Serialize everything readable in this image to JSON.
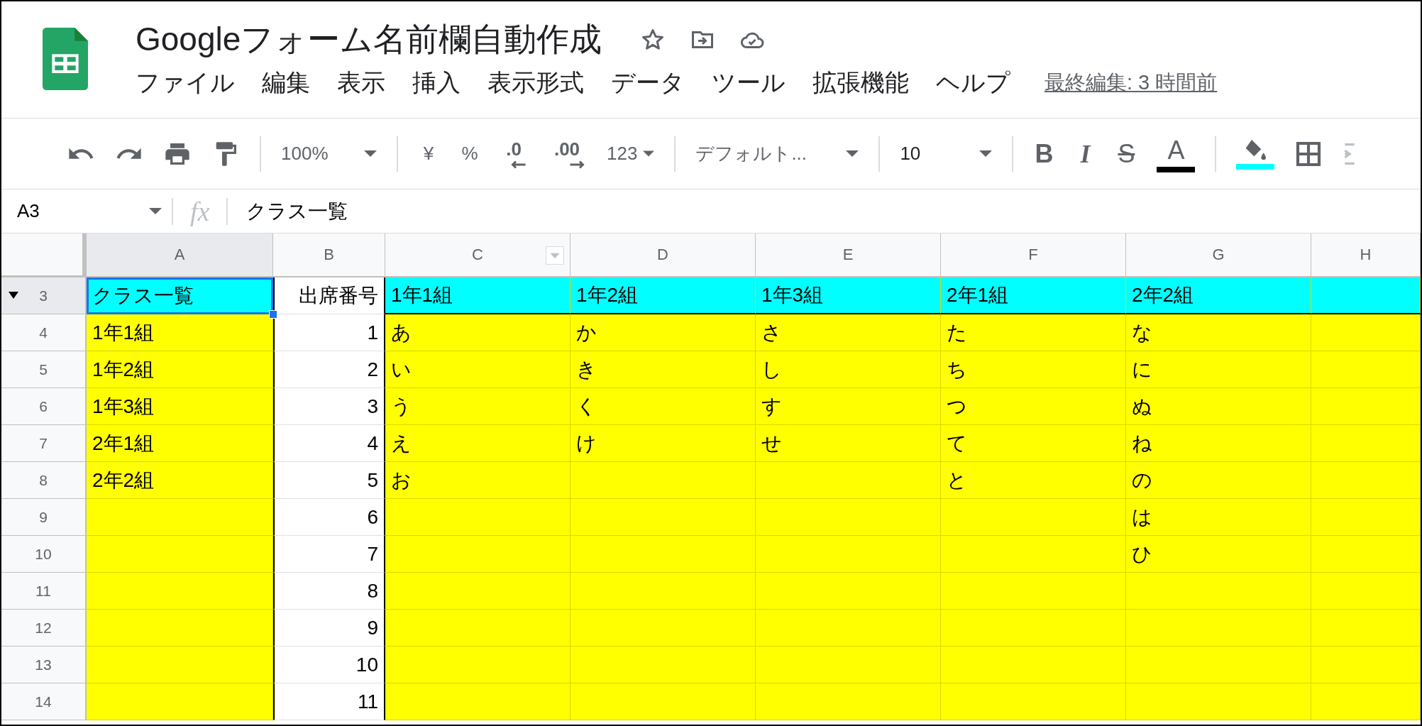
{
  "title": "Googleフォーム名前欄自動作成",
  "menu": [
    "ファイル",
    "編集",
    "表示",
    "挿入",
    "表示形式",
    "データ",
    "ツール",
    "拡張機能",
    "ヘルプ"
  ],
  "last_edit": "最終編集: 3 時間前",
  "toolbar": {
    "zoom": "100%",
    "currency": "¥",
    "percent": "%",
    "decimal_less": ".0",
    "decimal_more": ".00",
    "number_format": "123",
    "font": "デフォルト...",
    "font_size": "10",
    "bold": "B",
    "italic": "I",
    "strike": "S",
    "text_color_button": {
      "letter": "A",
      "color": "#000000"
    },
    "fill_color_button": {
      "color": "#00ffff"
    }
  },
  "name_box": "A3",
  "formula_icon": "fx",
  "formula": "クラス一覧",
  "columns": [
    {
      "label": "A",
      "selected": true,
      "filter": false
    },
    {
      "label": "B",
      "selected": false,
      "filter": false
    },
    {
      "label": "C",
      "selected": false,
      "filter": true
    },
    {
      "label": "D",
      "selected": false,
      "filter": false
    },
    {
      "label": "E",
      "selected": false,
      "filter": false
    },
    {
      "label": "F",
      "selected": false,
      "filter": false
    },
    {
      "label": "G",
      "selected": false,
      "filter": false
    },
    {
      "label": "H",
      "selected": false,
      "filter": false
    }
  ],
  "rows": [
    {
      "number": "3",
      "selected": true,
      "collapsible": true,
      "cells": [
        {
          "text": "クラス一覧",
          "color": "#00ffff",
          "selected": true
        },
        {
          "text": "出席番号",
          "color": "#ffffff",
          "selected": false
        },
        {
          "text": "1年1組",
          "color": "#00ffff",
          "selected": false
        },
        {
          "text": "1年2組",
          "color": "#00ffff",
          "selected": false
        },
        {
          "text": "1年3組",
          "color": "#00ffff",
          "selected": false
        },
        {
          "text": "2年1組",
          "color": "#00ffff",
          "selected": false
        },
        {
          "text": "2年2組",
          "color": "#00ffff",
          "selected": false
        },
        {
          "color": "#00ffff",
          "selected": false
        }
      ]
    },
    {
      "number": "4",
      "selected": false,
      "collapsible": false,
      "cells": [
        {
          "text": "1年1組",
          "color": "#ffff00",
          "selected": false
        },
        {
          "text": "1",
          "color": "#ffffff",
          "selected": false
        },
        {
          "text": "あ",
          "color": "#ffff00",
          "selected": false
        },
        {
          "text": "か",
          "color": "#ffff00",
          "selected": false
        },
        {
          "text": "さ",
          "color": "#ffff00",
          "selected": false
        },
        {
          "text": "た",
          "color": "#ffff00",
          "selected": false
        },
        {
          "text": "な",
          "color": "#ffff00",
          "selected": false
        },
        {
          "color": "#ffff00",
          "selected": false
        }
      ]
    },
    {
      "number": "5",
      "selected": false,
      "collapsible": false,
      "cells": [
        {
          "text": "1年2組",
          "color": "#ffff00",
          "selected": false
        },
        {
          "text": "2",
          "color": "#ffffff",
          "selected": false
        },
        {
          "text": "い",
          "color": "#ffff00",
          "selected": false
        },
        {
          "text": "き",
          "color": "#ffff00",
          "selected": false
        },
        {
          "text": "し",
          "color": "#ffff00",
          "selected": false
        },
        {
          "text": "ち",
          "color": "#ffff00",
          "selected": false
        },
        {
          "text": "に",
          "color": "#ffff00",
          "selected": false
        },
        {
          "color": "#ffff00",
          "selected": false
        }
      ]
    },
    {
      "number": "6",
      "selected": false,
      "collapsible": false,
      "cells": [
        {
          "text": "1年3組",
          "color": "#ffff00",
          "selected": false
        },
        {
          "text": "3",
          "color": "#ffffff",
          "selected": false
        },
        {
          "text": "う",
          "color": "#ffff00",
          "selected": false
        },
        {
          "text": "く",
          "color": "#ffff00",
          "selected": false
        },
        {
          "text": "す",
          "color": "#ffff00",
          "selected": false
        },
        {
          "text": "つ",
          "color": "#ffff00",
          "selected": false
        },
        {
          "text": "ぬ",
          "color": "#ffff00",
          "selected": false
        },
        {
          "color": "#ffff00",
          "selected": false
        }
      ]
    },
    {
      "number": "7",
      "selected": false,
      "collapsible": false,
      "cells": [
        {
          "text": "2年1組",
          "color": "#ffff00",
          "selected": false
        },
        {
          "text": "4",
          "color": "#ffffff",
          "selected": false
        },
        {
          "text": "え",
          "color": "#ffff00",
          "selected": false
        },
        {
          "text": "け",
          "color": "#ffff00",
          "selected": false
        },
        {
          "text": "せ",
          "color": "#ffff00",
          "selected": false
        },
        {
          "text": "て",
          "color": "#ffff00",
          "selected": false
        },
        {
          "text": "ね",
          "color": "#ffff00",
          "selected": false
        },
        {
          "color": "#ffff00",
          "selected": false
        }
      ]
    },
    {
      "number": "8",
      "selected": false,
      "collapsible": false,
      "cells": [
        {
          "text": "2年2組",
          "color": "#ffff00",
          "selected": false
        },
        {
          "text": "5",
          "color": "#ffffff",
          "selected": false
        },
        {
          "text": "お",
          "color": "#ffff00",
          "selected": false
        },
        {
          "color": "#ffff00",
          "selected": false
        },
        {
          "color": "#ffff00",
          "selected": false
        },
        {
          "text": "と",
          "color": "#ffff00",
          "selected": false
        },
        {
          "text": "の",
          "color": "#ffff00",
          "selected": false
        },
        {
          "color": "#ffff00",
          "selected": false
        }
      ]
    },
    {
      "number": "9",
      "selected": false,
      "collapsible": false,
      "cells": [
        {
          "color": "#ffff00",
          "selected": false
        },
        {
          "text": "6",
          "color": "#ffffff",
          "selected": false
        },
        {
          "color": "#ffff00",
          "selected": false
        },
        {
          "color": "#ffff00",
          "selected": false
        },
        {
          "color": "#ffff00",
          "selected": false
        },
        {
          "color": "#ffff00",
          "selected": false
        },
        {
          "text": "は",
          "color": "#ffff00",
          "selected": false
        },
        {
          "color": "#ffff00",
          "selected": false
        }
      ]
    },
    {
      "number": "10",
      "selected": false,
      "collapsible": false,
      "cells": [
        {
          "color": "#ffff00",
          "selected": false
        },
        {
          "text": "7",
          "color": "#ffffff",
          "selected": false
        },
        {
          "color": "#ffff00",
          "selected": false
        },
        {
          "color": "#ffff00",
          "selected": false
        },
        {
          "color": "#ffff00",
          "selected": false
        },
        {
          "color": "#ffff00",
          "selected": false
        },
        {
          "text": "ひ",
          "color": "#ffff00",
          "selected": false
        },
        {
          "color": "#ffff00",
          "selected": false
        }
      ]
    },
    {
      "number": "11",
      "selected": false,
      "collapsible": false,
      "cells": [
        {
          "color": "#ffff00",
          "selected": false
        },
        {
          "text": "8",
          "color": "#ffffff",
          "selected": false
        },
        {
          "color": "#ffff00",
          "selected": false
        },
        {
          "color": "#ffff00",
          "selected": false
        },
        {
          "color": "#ffff00",
          "selected": false
        },
        {
          "color": "#ffff00",
          "selected": false
        },
        {
          "color": "#ffff00",
          "selected": false
        },
        {
          "color": "#ffff00",
          "selected": false
        }
      ]
    },
    {
      "number": "12",
      "selected": false,
      "collapsible": false,
      "cells": [
        {
          "color": "#ffff00",
          "selected": false
        },
        {
          "text": "9",
          "color": "#ffffff",
          "selected": false
        },
        {
          "color": "#ffff00",
          "selected": false
        },
        {
          "color": "#ffff00",
          "selected": false
        },
        {
          "color": "#ffff00",
          "selected": false
        },
        {
          "color": "#ffff00",
          "selected": false
        },
        {
          "color": "#ffff00",
          "selected": false
        },
        {
          "color": "#ffff00",
          "selected": false
        }
      ]
    },
    {
      "number": "13",
      "selected": false,
      "collapsible": false,
      "cells": [
        {
          "color": "#ffff00",
          "selected": false
        },
        {
          "text": "10",
          "color": "#ffffff",
          "selected": false
        },
        {
          "color": "#ffff00",
          "selected": false
        },
        {
          "color": "#ffff00",
          "selected": false
        },
        {
          "color": "#ffff00",
          "selected": false
        },
        {
          "color": "#ffff00",
          "selected": false
        },
        {
          "color": "#ffff00",
          "selected": false
        },
        {
          "color": "#ffff00",
          "selected": false
        }
      ]
    },
    {
      "number": "14",
      "selected": false,
      "collapsible": false,
      "cells": [
        {
          "color": "#ffff00",
          "selected": false
        },
        {
          "text": "11",
          "color": "#ffffff",
          "selected": false
        },
        {
          "color": "#ffff00",
          "selected": false
        },
        {
          "color": "#ffff00",
          "selected": false
        },
        {
          "color": "#ffff00",
          "selected": false
        },
        {
          "color": "#ffff00",
          "selected": false
        },
        {
          "color": "#ffff00",
          "selected": false
        },
        {
          "color": "#ffff00",
          "selected": false
        }
      ]
    }
  ]
}
